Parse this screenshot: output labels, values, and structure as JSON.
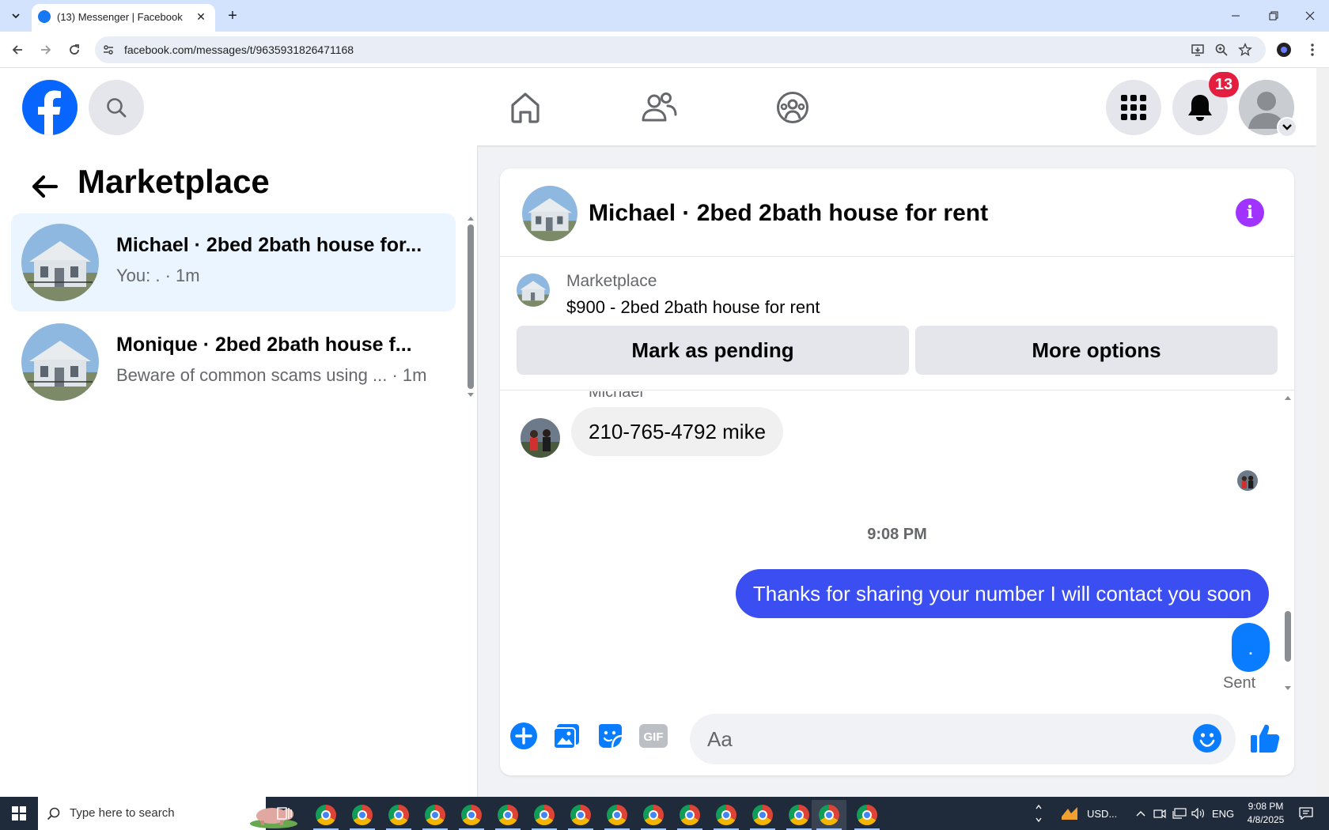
{
  "browser": {
    "tab_title": "(13) Messenger | Facebook",
    "url": "facebook.com/messages/t/9635931826471168"
  },
  "header": {
    "notification_count": "13"
  },
  "sidebar": {
    "title": "Marketplace",
    "conversations": [
      {
        "name": "Michael · 2bed 2bath house for...",
        "preview": "You: . · 1m",
        "active": true
      },
      {
        "name": "Monique · 2bed 2bath house f...",
        "preview": "Beware of common scams using ... · 1m",
        "active": false
      }
    ]
  },
  "chat": {
    "title": "Michael · 2bed 2bath house for rent",
    "listing": {
      "source": "Marketplace",
      "title": "$900 - 2bed 2bath house for rent",
      "mark_pending": "Mark as pending",
      "more_options": "More options"
    },
    "messages": {
      "sender": "Michael",
      "incoming": "210-765-4792 mike",
      "timestamp": "9:08 PM",
      "outgoing": "Thanks for sharing your number I will contact you soon",
      "outgoing_short": ".",
      "status": "Sent"
    },
    "composer": {
      "placeholder": "Aa",
      "gif_label": "GIF"
    }
  },
  "taskbar": {
    "search_placeholder": "Type here to search",
    "tray_currency": "USD...",
    "language": "ENG",
    "time": "9:08 PM",
    "date": "4/8/2025"
  },
  "colors": {
    "facebook_blue": "#0866ff",
    "messenger_blue": "#0a7cff",
    "outgoing_bubble": "#3a4ef1",
    "info_purple": "#a033ff",
    "badge_red": "#e41e3f"
  }
}
